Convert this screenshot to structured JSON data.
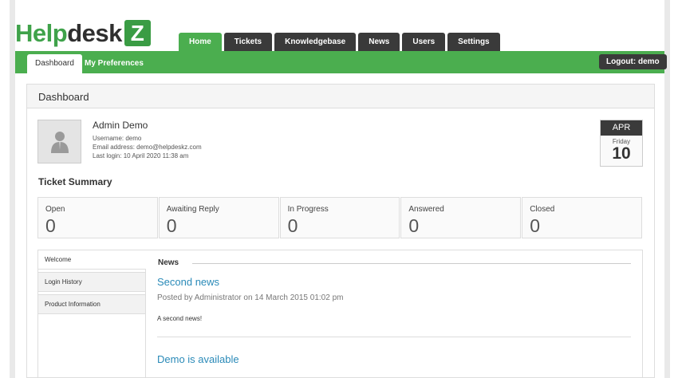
{
  "brand": {
    "logo_part1": "Help",
    "logo_part2": "desk",
    "logo_z": "Z"
  },
  "topnav": [
    "Home",
    "Tickets",
    "Knowledgebase",
    "News",
    "Users",
    "Settings"
  ],
  "subnav": {
    "dashboard": "Dashboard",
    "preferences": "My Preferences",
    "logout": "Logout: demo"
  },
  "panel": {
    "title": "Dashboard"
  },
  "user": {
    "name": "Admin Demo",
    "username": "Username: demo",
    "email": "Email address: demo@helpdeskz.com",
    "last_login": "Last login: 10 April 2020 11:38 am"
  },
  "calendar": {
    "month": "APR",
    "weekday": "Friday",
    "day": "10"
  },
  "summary": {
    "title": "Ticket Summary",
    "stats": [
      {
        "label": "Open",
        "value": "0"
      },
      {
        "label": "Awaiting Reply",
        "value": "0"
      },
      {
        "label": "In Progress",
        "value": "0"
      },
      {
        "label": "Answered",
        "value": "0"
      },
      {
        "label": "Closed",
        "value": "0"
      }
    ]
  },
  "sidetabs": [
    "Welcome",
    "Login History",
    "Product Information"
  ],
  "news": {
    "heading": "News",
    "items": [
      {
        "title": "Second news",
        "meta": "Posted by Administrator on 14 March 2015 01:02 pm",
        "body": "A second news!"
      },
      {
        "title": "Demo is available"
      }
    ]
  },
  "colors": {
    "accent": "#4bae4f",
    "dark": "#3a3a3a",
    "link": "#2a8ab8"
  }
}
